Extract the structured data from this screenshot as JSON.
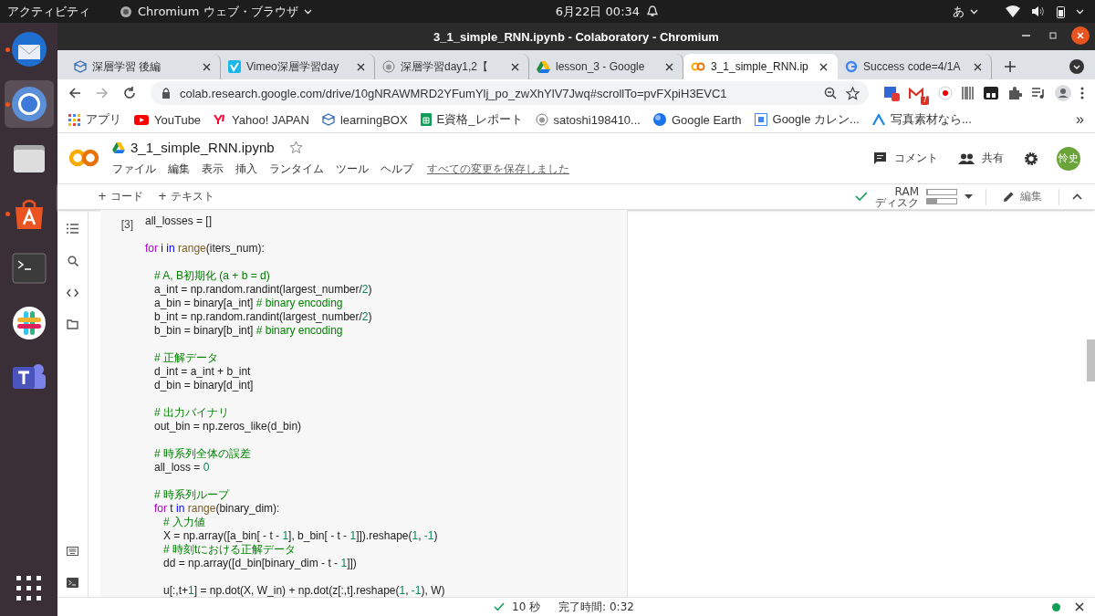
{
  "topbar": {
    "activities": "アクティビティ",
    "app_menu": "Chromium ウェブ・ブラウザ",
    "clock": "6月22日  00:34",
    "input_method": "あ"
  },
  "dock": [
    {
      "kind": "mail",
      "running": true,
      "selected": false
    },
    {
      "kind": "browser",
      "running": true,
      "selected": true
    },
    {
      "kind": "files",
      "running": false,
      "selected": false
    },
    {
      "kind": "store",
      "running": true,
      "selected": false
    },
    {
      "kind": "terminal",
      "running": false,
      "selected": false
    },
    {
      "kind": "chat",
      "running": false,
      "selected": false
    },
    {
      "kind": "teams",
      "running": false,
      "selected": false
    }
  ],
  "window": {
    "title": "3_1_simple_RNN.ipynb - Colaboratory - Chromium"
  },
  "tabs": [
    {
      "title": "深層学習 後編",
      "kind": "box",
      "selected": false
    },
    {
      "title": "Vimeo深層学習day",
      "kind": "vimeo",
      "selected": false
    },
    {
      "title": "深層学習day1,2【",
      "kind": "cat",
      "selected": false
    },
    {
      "title": "lesson_3 - Google",
      "kind": "drive",
      "selected": false
    },
    {
      "title": "3_1_simple_RNN.ip",
      "kind": "colab",
      "selected": true
    },
    {
      "title": "Success code=4/1A",
      "kind": "google",
      "selected": false
    }
  ],
  "address": "colab.research.google.com/drive/10gNRAWMRD2YFumYlj_po_zwXhYlV7Jwq#scrollTo=pvFXpiH3EVC1",
  "mail_badge": "7",
  "bookmarks": [
    {
      "label": "アプリ",
      "kind": "apps"
    },
    {
      "label": "YouTube",
      "kind": "youtube"
    },
    {
      "label": "Yahoo! JAPAN",
      "kind": "yahoo"
    },
    {
      "label": "learningBOX",
      "kind": "box"
    },
    {
      "label": "E資格_レポート",
      "kind": "sheet"
    },
    {
      "label": "satoshi198410...",
      "kind": "cat"
    },
    {
      "label": "Google Earth",
      "kind": "earth"
    },
    {
      "label": "Google カレン...",
      "kind": "calendar"
    },
    {
      "label": "写真素材なら...",
      "kind": "photo"
    }
  ],
  "bookmarks_more": "»",
  "notebook": {
    "name": "3_1_simple_RNN.ipynb",
    "menus": [
      "ファイル",
      "編集",
      "表示",
      "挿入",
      "ランタイム",
      "ツール",
      "ヘルプ"
    ],
    "save_status": "すべての変更を保存しました",
    "comment": "コメント",
    "share": "共有",
    "avatar": "怜史"
  },
  "toolbar": {
    "add_code": "+ コード",
    "add_text": "+ テキスト",
    "ram_label": "RAM",
    "ram": {
      "level": 0.04
    },
    "disk_label": "ディスク",
    "disk": {
      "level": 0.35
    },
    "edit": "編集"
  },
  "cell": {
    "exec_count": "[3]",
    "lines": [
      {
        "kind": "code",
        "tokens": [
          {
            "text": "all_losses = []",
            "kind": "plain"
          }
        ]
      },
      {
        "kind": "blank"
      },
      {
        "kind": "code",
        "tokens": [
          {
            "text": "for",
            "kind": "keyword"
          },
          {
            "text": " i ",
            "kind": "plain"
          },
          {
            "text": "in ",
            "kind": "operator"
          },
          {
            "text": "range",
            "kind": "builtin"
          },
          {
            "text": "(iters_num):",
            "kind": "plain"
          }
        ]
      },
      {
        "kind": "blank"
      },
      {
        "kind": "code",
        "tokens": [
          {
            "text": "   # A, B初期化 (a + b = d)",
            "kind": "comment"
          }
        ]
      },
      {
        "kind": "code",
        "tokens": [
          {
            "text": "   a_int = np.random.randint(largest_number/",
            "kind": "plain"
          },
          {
            "text": "2",
            "kind": "number"
          },
          {
            "text": ")",
            "kind": "plain"
          }
        ]
      },
      {
        "kind": "code",
        "tokens": [
          {
            "text": "   a_bin = binary[a_int] ",
            "kind": "plain"
          },
          {
            "text": "# binary encoding",
            "kind": "comment"
          }
        ]
      },
      {
        "kind": "code",
        "tokens": [
          {
            "text": "   b_int = np.random.randint(largest_number/",
            "kind": "plain"
          },
          {
            "text": "2",
            "kind": "number"
          },
          {
            "text": ")",
            "kind": "plain"
          }
        ]
      },
      {
        "kind": "code",
        "tokens": [
          {
            "text": "   b_bin = binary[b_int] ",
            "kind": "plain"
          },
          {
            "text": "# binary encoding",
            "kind": "comment"
          }
        ]
      },
      {
        "kind": "blank"
      },
      {
        "kind": "code",
        "tokens": [
          {
            "text": "   # 正解データ",
            "kind": "comment"
          }
        ]
      },
      {
        "kind": "code",
        "tokens": [
          {
            "text": "   d_int = a_int + b_int",
            "kind": "plain"
          }
        ]
      },
      {
        "kind": "code",
        "tokens": [
          {
            "text": "   d_bin = binary[d_int]",
            "kind": "plain"
          }
        ]
      },
      {
        "kind": "blank"
      },
      {
        "kind": "code",
        "tokens": [
          {
            "text": "   # 出力バイナリ",
            "kind": "comment"
          }
        ]
      },
      {
        "kind": "code",
        "tokens": [
          {
            "text": "   out_bin = np.zeros_like(d_bin)",
            "kind": "plain"
          }
        ]
      },
      {
        "kind": "blank"
      },
      {
        "kind": "code",
        "tokens": [
          {
            "text": "   # 時系列全体の誤差",
            "kind": "comment"
          }
        ]
      },
      {
        "kind": "code",
        "tokens": [
          {
            "text": "   all_loss = ",
            "kind": "plain"
          },
          {
            "text": "0",
            "kind": "number"
          }
        ]
      },
      {
        "kind": "blank"
      },
      {
        "kind": "code",
        "tokens": [
          {
            "text": "   # 時系列ループ",
            "kind": "comment"
          }
        ]
      },
      {
        "kind": "code",
        "tokens": [
          {
            "text": "   for",
            "kind": "keyword"
          },
          {
            "text": " t ",
            "kind": "plain"
          },
          {
            "text": "in ",
            "kind": "operator"
          },
          {
            "text": "range",
            "kind": "builtin"
          },
          {
            "text": "(binary_dim):",
            "kind": "plain"
          }
        ]
      },
      {
        "kind": "code",
        "tokens": [
          {
            "text": "      # 入力値",
            "kind": "comment"
          }
        ]
      },
      {
        "kind": "code",
        "tokens": [
          {
            "text": "      X = np.array([a_bin[ - t - ",
            "kind": "plain"
          },
          {
            "text": "1",
            "kind": "number"
          },
          {
            "text": "], b_bin[ - t - ",
            "kind": "plain"
          },
          {
            "text": "1",
            "kind": "number"
          },
          {
            "text": "]]).reshape(",
            "kind": "plain"
          },
          {
            "text": "1",
            "kind": "number"
          },
          {
            "text": ", ",
            "kind": "plain"
          },
          {
            "text": "-1",
            "kind": "number"
          },
          {
            "text": ")",
            "kind": "plain"
          }
        ]
      },
      {
        "kind": "code",
        "tokens": [
          {
            "text": "      # 時刻tにおける正解データ",
            "kind": "comment"
          }
        ]
      },
      {
        "kind": "code",
        "tokens": [
          {
            "text": "      dd = np.array([d_bin[binary_dim - t - ",
            "kind": "plain"
          },
          {
            "text": "1",
            "kind": "number"
          },
          {
            "text": "]])",
            "kind": "plain"
          }
        ]
      },
      {
        "kind": "blank"
      },
      {
        "kind": "code",
        "tokens": [
          {
            "text": "      u[:,t+",
            "kind": "plain"
          },
          {
            "text": "1",
            "kind": "number"
          },
          {
            "text": "] = np.dot(X, W_in) + np.dot(z[:,t].reshape(",
            "kind": "plain"
          },
          {
            "text": "1",
            "kind": "number"
          },
          {
            "text": ", ",
            "kind": "plain"
          },
          {
            "text": "-1",
            "kind": "number"
          },
          {
            "text": "), W)",
            "kind": "plain"
          }
        ]
      }
    ]
  },
  "status": {
    "elapsed": "10 秒",
    "finished": "完了時間: 0:32"
  }
}
